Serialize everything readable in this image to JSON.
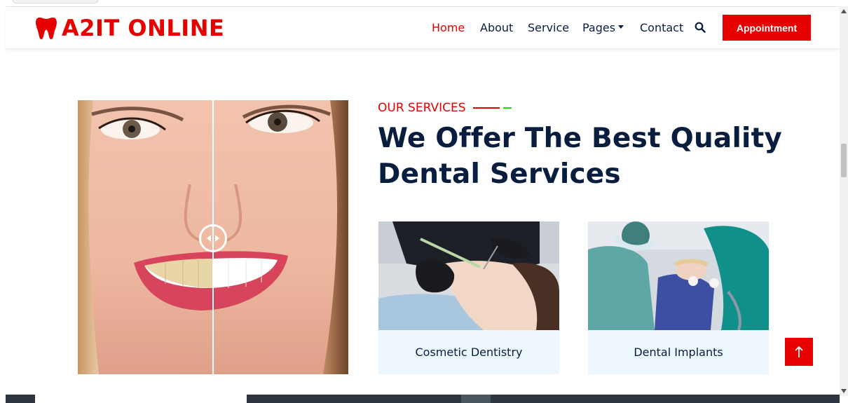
{
  "brand": {
    "name": "A2IT ONLINE",
    "logo_icon": "tooth-icon"
  },
  "nav": {
    "items": [
      {
        "label": "Home",
        "active": true
      },
      {
        "label": "About",
        "active": false
      },
      {
        "label": "Service",
        "active": false
      },
      {
        "label": "Pages",
        "active": false,
        "has_dropdown": true
      },
      {
        "label": "Contact",
        "active": false
      }
    ],
    "search_icon": "search-icon",
    "appointment_label": "Appointment"
  },
  "colors": {
    "accent": "#e60000",
    "accent_secondary": "#2ad400",
    "heading": "#091e3e",
    "card_bg": "#eef6fd"
  },
  "services": {
    "eyebrow": "OUR SERVICES",
    "heading_line1": "We Offer The Best Quality",
    "heading_line2": "Dental Services",
    "cards": [
      {
        "title": "Cosmetic Dentistry"
      },
      {
        "title": "Dental Implants"
      }
    ]
  },
  "back_to_top_icon": "arrow-up-icon"
}
